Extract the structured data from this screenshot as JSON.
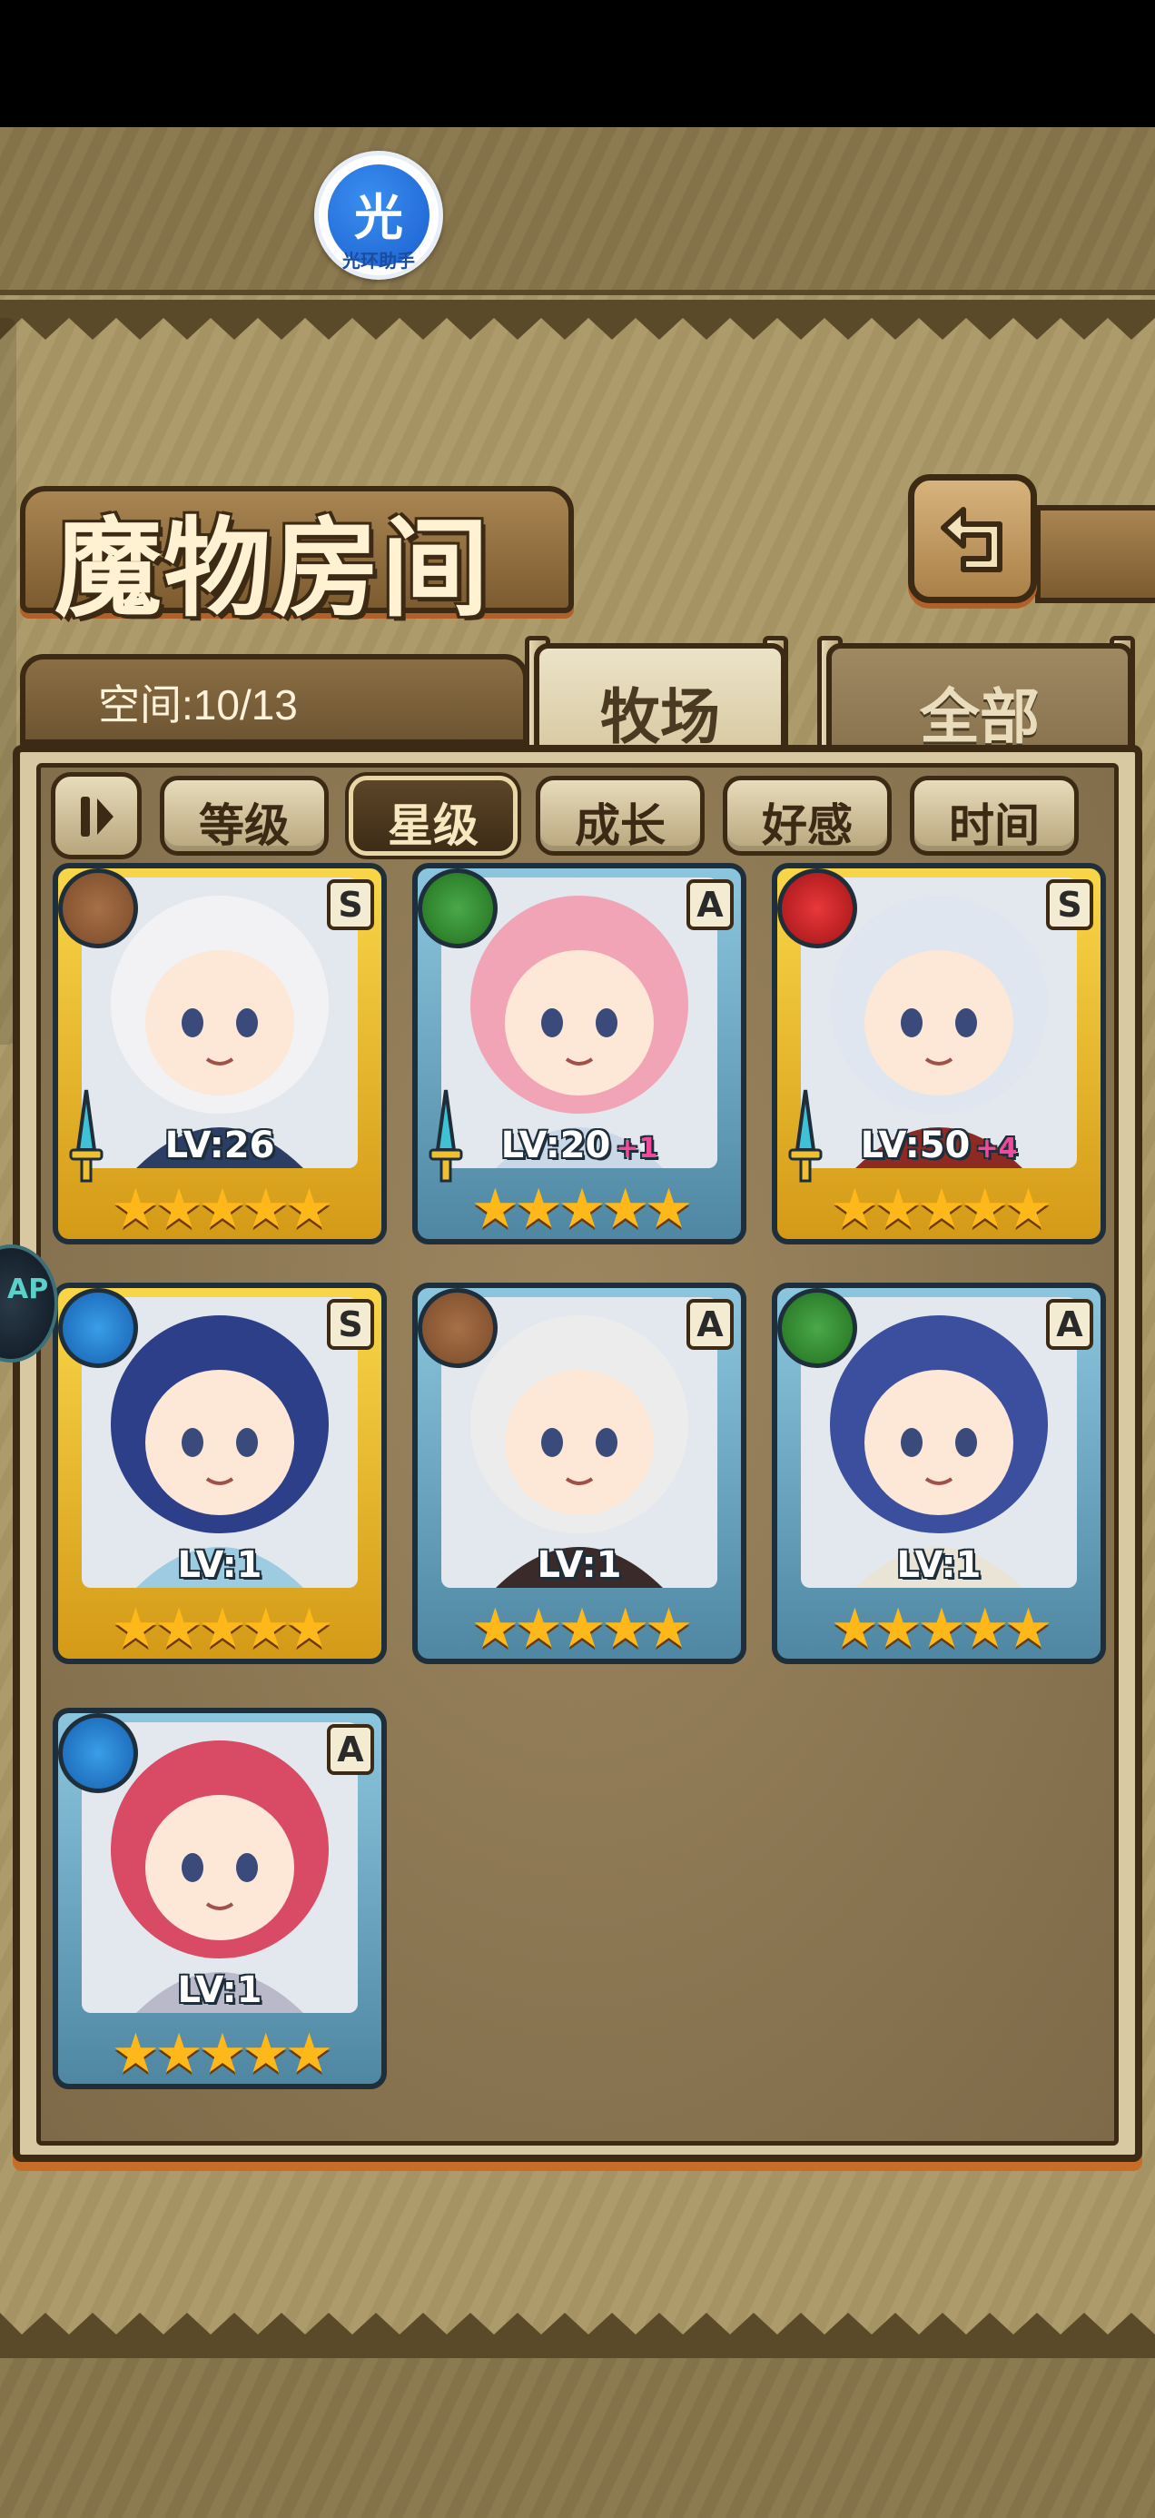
{
  "app": {
    "helper_glyph": "光",
    "helper_label": "光环助手",
    "floating_badge_text": "AP"
  },
  "header": {
    "title": "魔物房间",
    "back_icon": "back-arrow-icon"
  },
  "space": {
    "label": "空间:10/13"
  },
  "tabs": [
    {
      "label": "牧场",
      "selected": true
    },
    {
      "label": "全部",
      "selected": false
    }
  ],
  "sort": {
    "toggle_icon": "sort-order-icon",
    "options": [
      {
        "label": "等级",
        "selected": false
      },
      {
        "label": "星级",
        "selected": true
      },
      {
        "label": "成长",
        "selected": false
      },
      {
        "label": "好感",
        "selected": false
      },
      {
        "label": "时间",
        "selected": false
      }
    ]
  },
  "monsters": [
    {
      "rank": "S",
      "element": "earth",
      "level": "LV:26",
      "bonus": "",
      "stars": 5,
      "equipped": true,
      "hair": "#f2f2f4",
      "outfit": "#2c3e66"
    },
    {
      "rank": "A",
      "element": "wood",
      "level": "LV:20",
      "bonus": "+1",
      "stars": 5,
      "equipped": true,
      "hair": "#f0a4b6",
      "outfit": "#c9d7e6"
    },
    {
      "rank": "S",
      "element": "fire",
      "level": "LV:50",
      "bonus": "+4",
      "stars": 5,
      "equipped": true,
      "hair": "#dfe6f0",
      "outfit": "#8b2b24"
    },
    {
      "rank": "S",
      "element": "water",
      "level": "LV:1",
      "bonus": "",
      "stars": 5,
      "equipped": false,
      "hair": "#2e3f8a",
      "outfit": "#9ccbe2"
    },
    {
      "rank": "A",
      "element": "earth",
      "level": "LV:1",
      "bonus": "",
      "stars": 5,
      "equipped": false,
      "hair": "#ececec",
      "outfit": "#3a2a2a"
    },
    {
      "rank": "A",
      "element": "wood",
      "level": "LV:1",
      "bonus": "",
      "stars": 5,
      "equipped": false,
      "hair": "#3b4f9e",
      "outfit": "#e9e4d6"
    },
    {
      "rank": "A",
      "element": "water",
      "level": "LV:1",
      "bonus": "",
      "stars": 5,
      "equipped": false,
      "hair": "#d94a64",
      "outfit": "#b9b9c9"
    }
  ],
  "colors": {
    "rank_S": "#f2c531",
    "rank_A": "#6fa8c4",
    "star": "#ffb81a",
    "bonus": "#f04a9a"
  }
}
